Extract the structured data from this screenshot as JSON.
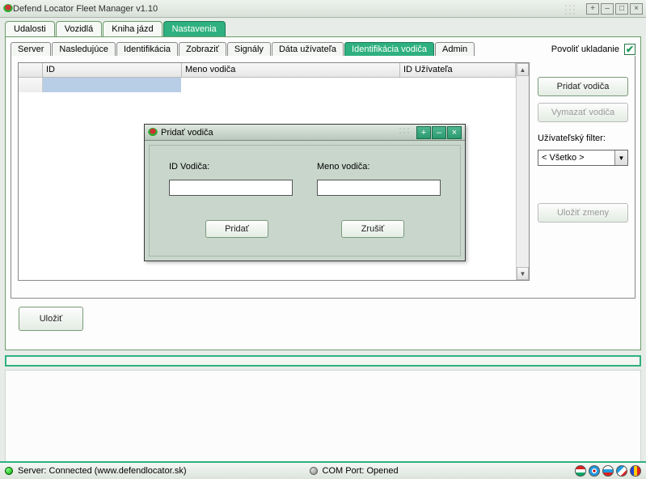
{
  "window": {
    "title": "Defend Locator Fleet Manager v1.10"
  },
  "main_tabs": [
    "Udalosti",
    "Vozidlá",
    "Kniha jázd",
    "Nastavenia"
  ],
  "main_tab_active": 3,
  "sub_tabs": [
    "Server",
    "Nasledujúce",
    "Identifikácia",
    "Zobraziť",
    "Signály",
    "Dáta užívateľa",
    "Identifikácia vodiča",
    "Admin"
  ],
  "sub_tab_active": 6,
  "allow_save": {
    "label": "Povoliť ukladanie",
    "checked": true
  },
  "table": {
    "headers": [
      "",
      "ID",
      "Meno vodiča",
      "ID Užívateľa"
    ]
  },
  "side": {
    "add": "Pridať vodiča",
    "delete": "Vymazať vodiča",
    "filter_label": "Užívateľský filter:",
    "filter_value": "< Všetko >",
    "save_changes": "Uložiť zmeny"
  },
  "bottom": {
    "save": "Uložiť"
  },
  "status": {
    "server": "Server: Connected (www.defendlocator.sk)",
    "com": "COM Port: Opened"
  },
  "dialog": {
    "title": "Pridať vodiča",
    "id_label": "ID Vodiča:",
    "name_label": "Meno vodiča:",
    "id_value": "",
    "name_value": "",
    "add": "Pridať",
    "cancel": "Zrušiť"
  }
}
